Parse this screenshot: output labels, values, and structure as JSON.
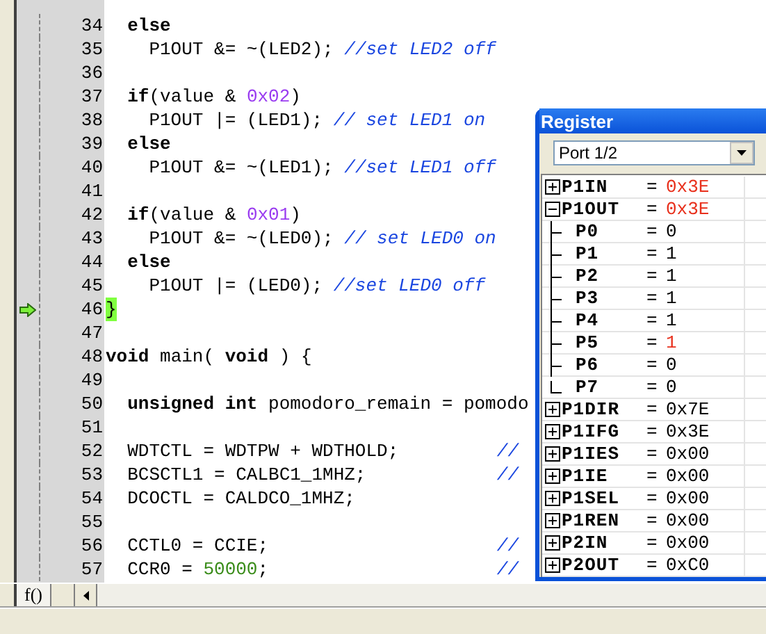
{
  "editor": {
    "lines": [
      {
        "number": "34",
        "current": false,
        "tokens": [
          {
            "kind": "keyword",
            "text": "  else"
          }
        ]
      },
      {
        "number": "35",
        "current": false,
        "tokens": [
          {
            "kind": "plain",
            "text": "    P1OUT &= ~(LED2); "
          },
          {
            "kind": "comment",
            "text": "//set LED2 off"
          }
        ]
      },
      {
        "number": "36",
        "current": false
      },
      {
        "number": "37",
        "current": false,
        "tokens": [
          {
            "kind": "keyword",
            "text": "  if"
          },
          {
            "kind": "plain",
            "text": "(value & "
          },
          {
            "kind": "hex",
            "text": "0x02"
          },
          {
            "kind": "plain",
            "text": ")"
          }
        ]
      },
      {
        "number": "38",
        "current": false,
        "tokens": [
          {
            "kind": "plain",
            "text": "    P1OUT |= (LED1); "
          },
          {
            "kind": "comment",
            "text": "// set LED1 on"
          }
        ]
      },
      {
        "number": "39",
        "current": false,
        "tokens": [
          {
            "kind": "keyword",
            "text": "  else"
          }
        ]
      },
      {
        "number": "40",
        "current": false,
        "tokens": [
          {
            "kind": "plain",
            "text": "    P1OUT &= ~(LED1); "
          },
          {
            "kind": "comment",
            "text": "//set LED1 off"
          }
        ]
      },
      {
        "number": "41",
        "current": false
      },
      {
        "number": "42",
        "current": false,
        "tokens": [
          {
            "kind": "keyword",
            "text": "  if"
          },
          {
            "kind": "plain",
            "text": "(value & "
          },
          {
            "kind": "hex",
            "text": "0x01"
          },
          {
            "kind": "plain",
            "text": ")"
          }
        ]
      },
      {
        "number": "43",
        "current": false,
        "tokens": [
          {
            "kind": "plain",
            "text": "    P1OUT &= ~(LED0); "
          },
          {
            "kind": "comment",
            "text": "// set LED0 on"
          }
        ]
      },
      {
        "number": "44",
        "current": false,
        "tokens": [
          {
            "kind": "keyword",
            "text": "  else"
          }
        ]
      },
      {
        "number": "45",
        "current": false,
        "tokens": [
          {
            "kind": "plain",
            "text": "    P1OUT |= (LED0); "
          },
          {
            "kind": "comment",
            "text": "//set LED0 off"
          }
        ]
      },
      {
        "number": "46",
        "current": true,
        "tokens": [
          {
            "kind": "plain",
            "text": "}"
          }
        ]
      },
      {
        "number": "47",
        "current": false
      },
      {
        "number": "48",
        "current": false,
        "tokens": [
          {
            "kind": "keyword",
            "text": "void"
          },
          {
            "kind": "plain",
            "text": " main( "
          },
          {
            "kind": "keyword",
            "text": "void"
          },
          {
            "kind": "plain",
            "text": " ) {"
          }
        ]
      },
      {
        "number": "49",
        "current": false
      },
      {
        "number": "50",
        "current": false,
        "tokens": [
          {
            "kind": "keyword",
            "text": "  unsigned int"
          },
          {
            "kind": "plain",
            "text": " pomodoro_remain = pomodo"
          }
        ]
      },
      {
        "number": "51",
        "current": false
      },
      {
        "number": "52",
        "current": false,
        "tokens": [
          {
            "kind": "plain",
            "text": "  WDTCTL = WDTPW + WDTHOLD;"
          },
          {
            "kind": "aligned_comment",
            "text": "//"
          }
        ]
      },
      {
        "number": "53",
        "current": false,
        "tokens": [
          {
            "kind": "plain",
            "text": "  BCSCTL1 = CALBC1_1MHZ;"
          },
          {
            "kind": "aligned_comment",
            "text": "//"
          }
        ]
      },
      {
        "number": "54",
        "current": false,
        "tokens": [
          {
            "kind": "plain",
            "text": "  DCOCTL = CALDCO_1MHZ;"
          }
        ]
      },
      {
        "number": "55",
        "current": false
      },
      {
        "number": "56",
        "current": false,
        "tokens": [
          {
            "kind": "plain",
            "text": "  CCTL0 = CCIE;"
          },
          {
            "kind": "aligned_comment",
            "text": "//"
          }
        ]
      },
      {
        "number": "57",
        "current": false,
        "tokens": [
          {
            "kind": "plain",
            "text": "  CCR0 = "
          },
          {
            "kind": "decimal",
            "text": "50000"
          },
          {
            "kind": "plain",
            "text": ";"
          },
          {
            "kind": "aligned_comment",
            "text": "//"
          }
        ]
      }
    ],
    "function_tab": "f()"
  },
  "register_window": {
    "title": "Register",
    "group": "Port 1/2",
    "registers": [
      {
        "name": "P1IN",
        "operator": "=",
        "value": "0x3E",
        "changed": true,
        "expanded": false
      },
      {
        "name": "P1OUT",
        "operator": "=",
        "value": "0x3E",
        "changed": true,
        "expanded": true,
        "children": [
          {
            "name": "P0",
            "operator": "=",
            "value": "0",
            "changed": false
          },
          {
            "name": "P1",
            "operator": "=",
            "value": "1",
            "changed": false
          },
          {
            "name": "P2",
            "operator": "=",
            "value": "1",
            "changed": false
          },
          {
            "name": "P3",
            "operator": "=",
            "value": "1",
            "changed": false
          },
          {
            "name": "P4",
            "operator": "=",
            "value": "1",
            "changed": false
          },
          {
            "name": "P5",
            "operator": "=",
            "value": "1",
            "changed": true
          },
          {
            "name": "P6",
            "operator": "=",
            "value": "0",
            "changed": false
          },
          {
            "name": "P7",
            "operator": "=",
            "value": "0",
            "changed": false
          }
        ]
      },
      {
        "name": "P1DIR",
        "operator": "=",
        "value": "0x7E",
        "changed": false,
        "expanded": false
      },
      {
        "name": "P1IFG",
        "operator": "=",
        "value": "0x3E",
        "changed": false,
        "expanded": false
      },
      {
        "name": "P1IES",
        "operator": "=",
        "value": "0x00",
        "changed": false,
        "expanded": false
      },
      {
        "name": "P1IE",
        "operator": "=",
        "value": "0x00",
        "changed": false,
        "expanded": false
      },
      {
        "name": "P1SEL",
        "operator": "=",
        "value": "0x00",
        "changed": false,
        "expanded": false
      },
      {
        "name": "P1REN",
        "operator": "=",
        "value": "0x00",
        "changed": false,
        "expanded": false
      },
      {
        "name": "P2IN",
        "operator": "=",
        "value": "0x00",
        "changed": false,
        "expanded": false
      },
      {
        "name": "P2OUT",
        "operator": "=",
        "value": "0xC0",
        "changed": false,
        "expanded": false
      }
    ]
  }
}
